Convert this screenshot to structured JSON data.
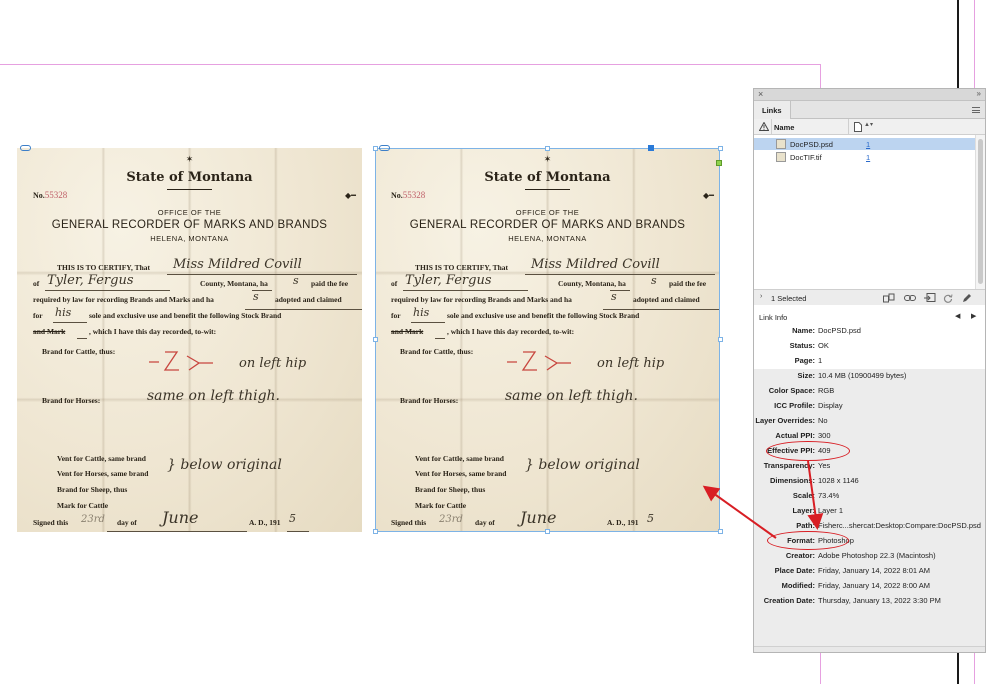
{
  "document": {
    "title": "State of Montana",
    "number_prefix": "No.",
    "number_value": "55328",
    "office_line": "OFFICE OF THE",
    "general_line": "GENERAL RECORDER OF MARKS AND BRANDS",
    "helena_line": "HELENA, MONTANA",
    "certify": "THIS IS TO CERTIFY, That",
    "certify_hand": "Miss Mildred Covill",
    "of_label": "of",
    "of_hand": "Tyler, Fergus",
    "county_text": "County, Montana, ha",
    "county_hand": "s",
    "paid_fee": "paid the fee",
    "required": "required by law for recording Brands and Marks and ha",
    "required_hand": "s",
    "adopted": "adopted and claimed",
    "for_label": "for",
    "for_hand": "his",
    "sole": "sole and exclusive use and benefit the following Stock Brand",
    "and_mark": "and Mark",
    "which": ", which I have this day recorded, to-wit:",
    "brand_cattle": "Brand for Cattle, thus:",
    "brand_cattle_hand": "on left hip",
    "brand_horses": "Brand for Horses:",
    "brand_horses_hand": "same on left thigh.",
    "vent_cattle": "Vent for Cattle, same brand",
    "vent_horses": "Vent for Horses, same brand",
    "vent_hand": "} below original",
    "brand_sheep": "Brand for Sheep, thus",
    "mark_cattle": "Mark for Cattle",
    "signed": "Signed this",
    "signed_day": "23rd",
    "day_of": "day of",
    "month_hand": "June",
    "ad": "A. D., 191",
    "ad_hand": "5"
  },
  "panel": {
    "close_glyph": "×",
    "collapse_glyph": "»",
    "tab_label": "Links",
    "menu_icon": "panel-menu-icon",
    "column_name": "Name",
    "files": [
      {
        "name": "DocPSD.psd",
        "page": "1",
        "selected": true
      },
      {
        "name": "DocTIF.tif",
        "page": "1",
        "selected": false
      }
    ],
    "selected_count": "1 Selected",
    "link_info_label": "Link Info",
    "info": [
      {
        "key": "Name:",
        "value": "DocPSD.psd"
      },
      {
        "key": "Status:",
        "value": "OK"
      },
      {
        "key": "Page:",
        "value": "1"
      },
      {
        "key": "Size:",
        "value": "10.4 MB (10900499 bytes)"
      },
      {
        "key": "Color Space:",
        "value": "RGB"
      },
      {
        "key": "ICC Profile:",
        "value": "Display"
      },
      {
        "key": "Layer Overrides:",
        "value": "No"
      },
      {
        "key": "Actual PPI:",
        "value": "300"
      },
      {
        "key": "Effective PPI:",
        "value": "409"
      },
      {
        "key": "Transparency:",
        "value": "Yes"
      },
      {
        "key": "Dimensions:",
        "value": "1028 x 1146"
      },
      {
        "key": "Scale:",
        "value": "73.4%"
      },
      {
        "key": "Layer:",
        "value": "Layer 1"
      },
      {
        "key": "Path:",
        "value": "Fisherc...shercat:Desktop:Compare:DocPSD.psd"
      },
      {
        "key": "Format:",
        "value": "Photoshop"
      },
      {
        "key": "Creator:",
        "value": "Adobe Photoshop 22.3 (Macintosh)"
      },
      {
        "key": "Place Date:",
        "value": "Friday, January 14, 2022 8:01 AM"
      },
      {
        "key": "Modified:",
        "value": "Friday, January 14, 2022 8:00 AM"
      },
      {
        "key": "Creation Date:",
        "value": "Thursday, January 13, 2022 3:30 PM"
      }
    ]
  },
  "colors": {
    "annotation_red": "#d81e24",
    "guide_magenta": "#e08ad8",
    "selection_blue": "#7db3e6",
    "row_selected": "#bcd4f0"
  }
}
